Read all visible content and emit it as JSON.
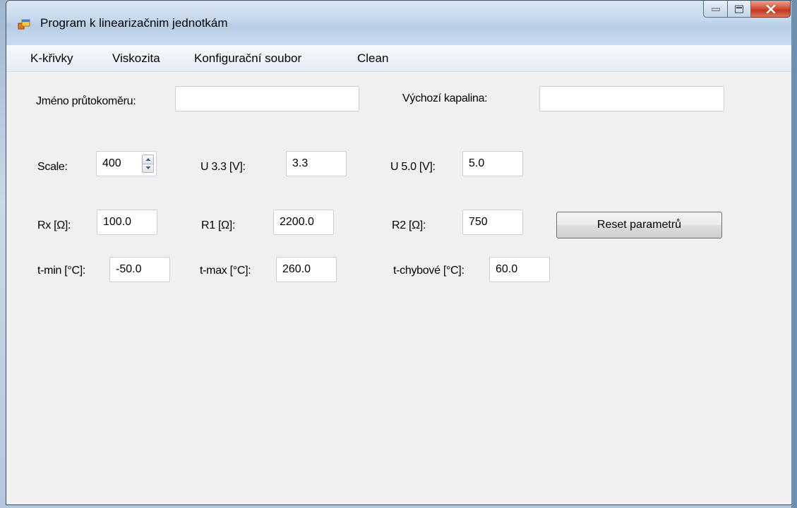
{
  "window": {
    "title": "Program k linearizačnim jednotkám",
    "icon": "app-window-icon",
    "buttons": [
      "minimize-icon",
      "maximize-icon",
      "close-icon"
    ]
  },
  "menu": {
    "items": [
      "K-křivky",
      "Viskozita",
      "Konfigurační soubor",
      "Clean"
    ]
  },
  "form": {
    "flowmeter_name": {
      "label": "Jméno průtokoměru:",
      "value": ""
    },
    "default_liquid": {
      "label": "Výchozí kapalina:",
      "value": ""
    },
    "scale": {
      "label": "Scale:",
      "value": "400"
    },
    "u33": {
      "label": "U 3.3 [V]:",
      "value": "3.3"
    },
    "u50": {
      "label": "U 5.0 [V]:",
      "value": "5.0"
    },
    "rx": {
      "label": "Rx [Ω]:",
      "value": "100.0"
    },
    "r1": {
      "label": "R1 [Ω]:",
      "value": "2200.0"
    },
    "r2": {
      "label": "R2 [Ω]:",
      "value": "750"
    },
    "reset_button": "Reset parametrů",
    "tmin": {
      "label": "t-min [°C]:",
      "value": "-50.0"
    },
    "tmax": {
      "label": "t-max [°C]:",
      "value": "260.0"
    },
    "terr": {
      "label": "t-chybové [°C]:",
      "value": "60.0"
    }
  },
  "colors": {
    "window_bg": "#f0f0f0",
    "close_button": "#c3371d"
  }
}
